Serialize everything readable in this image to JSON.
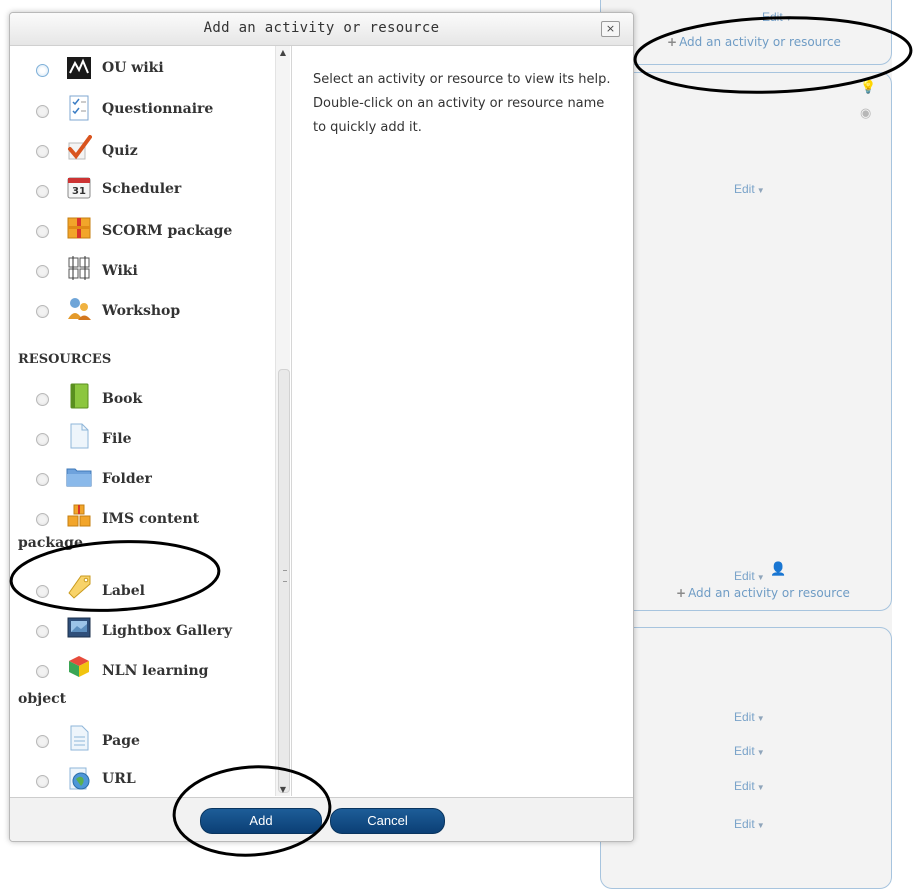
{
  "background": {
    "edit_label": "Edit",
    "add_link": "Add an activity or resource"
  },
  "dialog": {
    "title": "Add an activity or resource",
    "close_symbol": "×",
    "help_text": "Select an activity or resource to view its help. Double-click on an activity or resource name to quickly add it.",
    "add_button": "Add",
    "cancel_button": "Cancel",
    "activities": [
      {
        "label": "OU wiki",
        "icon": "ou-wiki-icon"
      },
      {
        "label": "Questionnaire",
        "icon": "questionnaire-icon"
      },
      {
        "label": "Quiz",
        "icon": "quiz-icon"
      },
      {
        "label": "Scheduler",
        "icon": "scheduler-icon",
        "icon_text": "31"
      },
      {
        "label": "SCORM package",
        "icon": "scorm-icon"
      },
      {
        "label": "Wiki",
        "icon": "wiki-icon"
      },
      {
        "label": "Workshop",
        "icon": "workshop-icon"
      }
    ],
    "resources_heading": "RESOURCES",
    "resources": [
      {
        "label": "Book",
        "icon": "book-icon"
      },
      {
        "label": "File",
        "icon": "file-icon"
      },
      {
        "label": "Folder",
        "icon": "folder-icon"
      },
      {
        "label": "IMS content",
        "label_wrap": "package",
        "icon": "ims-content-icon"
      },
      {
        "label": "Label",
        "icon": "label-icon"
      },
      {
        "label": "Lightbox Gallery",
        "icon": "lightbox-gallery-icon"
      },
      {
        "label": "NLN learning",
        "label_wrap": "object",
        "icon": "nln-learning-icon"
      },
      {
        "label": "Page",
        "icon": "page-icon"
      },
      {
        "label": "URL",
        "icon": "url-icon"
      }
    ]
  },
  "colors": {
    "button_blue": "#0b3f75",
    "link_blue": "#6f9cc5",
    "annotation": "#000000"
  }
}
